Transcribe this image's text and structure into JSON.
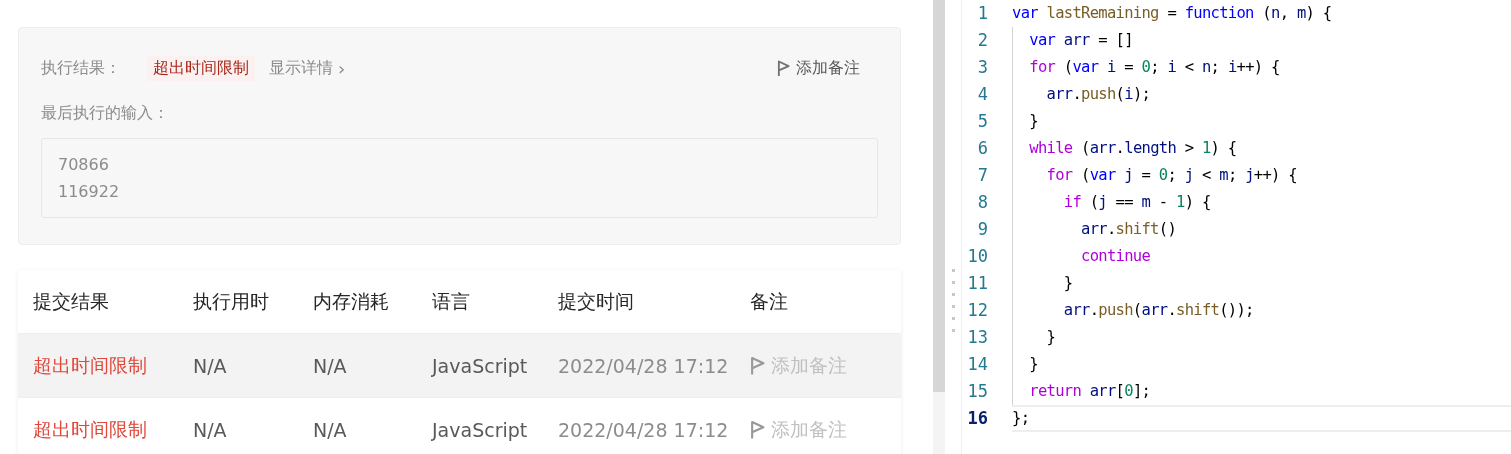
{
  "result_panel": {
    "result_label": "执行结果：",
    "result_badge": "超出时间限制",
    "details_link": "显示详情",
    "details_chevron": "›",
    "add_note": "添加备注",
    "last_input_label": "最后执行的输入：",
    "last_input_lines": [
      "70866",
      "116922"
    ]
  },
  "submissions": {
    "columns": [
      "提交结果",
      "执行用时",
      "内存消耗",
      "语言",
      "提交时间",
      "备注"
    ],
    "rows": [
      {
        "result": "超出时间限制",
        "runtime": "N/A",
        "memory": "N/A",
        "language": "JavaScript",
        "time": "2022/04/28 17:12",
        "note": "添加备注",
        "highlighted": true
      },
      {
        "result": "超出时间限制",
        "runtime": "N/A",
        "memory": "N/A",
        "language": "JavaScript",
        "time": "2022/04/28 17:12",
        "note": "添加备注",
        "highlighted": false
      }
    ]
  },
  "editor": {
    "lines": [
      {
        "number": "1",
        "active": false,
        "tokens": [
          {
            "text": "var ",
            "kind": "storage"
          },
          {
            "text": "lastRemaining",
            "kind": "func"
          },
          {
            "text": " = ",
            "kind": "punct"
          },
          {
            "text": "function",
            "kind": "storage"
          },
          {
            "text": " (",
            "kind": "punct"
          },
          {
            "text": "n",
            "kind": "name"
          },
          {
            "text": ", ",
            "kind": "punct"
          },
          {
            "text": "m",
            "kind": "name"
          },
          {
            "text": ") {",
            "kind": "punct"
          }
        ]
      },
      {
        "number": "2",
        "active": false,
        "tokens": [
          {
            "text": "  var ",
            "kind": "storage"
          },
          {
            "text": "arr",
            "kind": "name"
          },
          {
            "text": " = []",
            "kind": "punct"
          }
        ]
      },
      {
        "number": "3",
        "active": false,
        "tokens": [
          {
            "text": "  for",
            "kind": "keyword"
          },
          {
            "text": " (",
            "kind": "punct"
          },
          {
            "text": "var ",
            "kind": "storage"
          },
          {
            "text": "i",
            "kind": "name"
          },
          {
            "text": " = ",
            "kind": "punct"
          },
          {
            "text": "0",
            "kind": "number"
          },
          {
            "text": "; ",
            "kind": "punct"
          },
          {
            "text": "i",
            "kind": "name"
          },
          {
            "text": " < ",
            "kind": "punct"
          },
          {
            "text": "n",
            "kind": "name"
          },
          {
            "text": "; ",
            "kind": "punct"
          },
          {
            "text": "i",
            "kind": "name"
          },
          {
            "text": "++) {",
            "kind": "punct"
          }
        ]
      },
      {
        "number": "4",
        "active": false,
        "tokens": [
          {
            "text": "    arr",
            "kind": "name"
          },
          {
            "text": ".",
            "kind": "punct"
          },
          {
            "text": "push",
            "kind": "func"
          },
          {
            "text": "(",
            "kind": "punct"
          },
          {
            "text": "i",
            "kind": "name"
          },
          {
            "text": ");",
            "kind": "punct"
          }
        ]
      },
      {
        "number": "5",
        "active": false,
        "tokens": [
          {
            "text": "  }",
            "kind": "punct"
          }
        ]
      },
      {
        "number": "6",
        "active": false,
        "tokens": [
          {
            "text": "  while",
            "kind": "keyword"
          },
          {
            "text": " (",
            "kind": "punct"
          },
          {
            "text": "arr",
            "kind": "name"
          },
          {
            "text": ".",
            "kind": "punct"
          },
          {
            "text": "length",
            "kind": "name"
          },
          {
            "text": " > ",
            "kind": "punct"
          },
          {
            "text": "1",
            "kind": "number"
          },
          {
            "text": ") {",
            "kind": "punct"
          }
        ]
      },
      {
        "number": "7",
        "active": false,
        "tokens": [
          {
            "text": "    for",
            "kind": "keyword"
          },
          {
            "text": " (",
            "kind": "punct"
          },
          {
            "text": "var ",
            "kind": "storage"
          },
          {
            "text": "j",
            "kind": "name"
          },
          {
            "text": " = ",
            "kind": "punct"
          },
          {
            "text": "0",
            "kind": "number"
          },
          {
            "text": "; ",
            "kind": "punct"
          },
          {
            "text": "j",
            "kind": "name"
          },
          {
            "text": " < ",
            "kind": "punct"
          },
          {
            "text": "m",
            "kind": "name"
          },
          {
            "text": "; ",
            "kind": "punct"
          },
          {
            "text": "j",
            "kind": "name"
          },
          {
            "text": "++) {",
            "kind": "punct"
          }
        ]
      },
      {
        "number": "8",
        "active": false,
        "tokens": [
          {
            "text": "      if",
            "kind": "keyword"
          },
          {
            "text": " (",
            "kind": "punct"
          },
          {
            "text": "j",
            "kind": "name"
          },
          {
            "text": " == ",
            "kind": "punct"
          },
          {
            "text": "m",
            "kind": "name"
          },
          {
            "text": " - ",
            "kind": "punct"
          },
          {
            "text": "1",
            "kind": "number"
          },
          {
            "text": ") {",
            "kind": "punct"
          }
        ]
      },
      {
        "number": "9",
        "active": false,
        "tokens": [
          {
            "text": "        arr",
            "kind": "name"
          },
          {
            "text": ".",
            "kind": "punct"
          },
          {
            "text": "shift",
            "kind": "func"
          },
          {
            "text": "()",
            "kind": "punct"
          }
        ]
      },
      {
        "number": "10",
        "active": false,
        "tokens": [
          {
            "text": "        continue",
            "kind": "keyword"
          }
        ]
      },
      {
        "number": "11",
        "active": false,
        "tokens": [
          {
            "text": "      }",
            "kind": "punct"
          }
        ]
      },
      {
        "number": "12",
        "active": false,
        "tokens": [
          {
            "text": "      arr",
            "kind": "name"
          },
          {
            "text": ".",
            "kind": "punct"
          },
          {
            "text": "push",
            "kind": "func"
          },
          {
            "text": "(",
            "kind": "punct"
          },
          {
            "text": "arr",
            "kind": "name"
          },
          {
            "text": ".",
            "kind": "punct"
          },
          {
            "text": "shift",
            "kind": "func"
          },
          {
            "text": "());",
            "kind": "punct"
          }
        ]
      },
      {
        "number": "13",
        "active": false,
        "tokens": [
          {
            "text": "    }",
            "kind": "punct"
          }
        ]
      },
      {
        "number": "14",
        "active": false,
        "tokens": [
          {
            "text": "  }",
            "kind": "punct"
          }
        ]
      },
      {
        "number": "15",
        "active": false,
        "tokens": [
          {
            "text": "  return ",
            "kind": "keyword"
          },
          {
            "text": "arr",
            "kind": "name"
          },
          {
            "text": "[",
            "kind": "punct"
          },
          {
            "text": "0",
            "kind": "number"
          },
          {
            "text": "];",
            "kind": "punct"
          }
        ]
      },
      {
        "number": "16",
        "active": true,
        "tokens": [
          {
            "text": "};",
            "kind": "punct"
          }
        ]
      }
    ]
  }
}
